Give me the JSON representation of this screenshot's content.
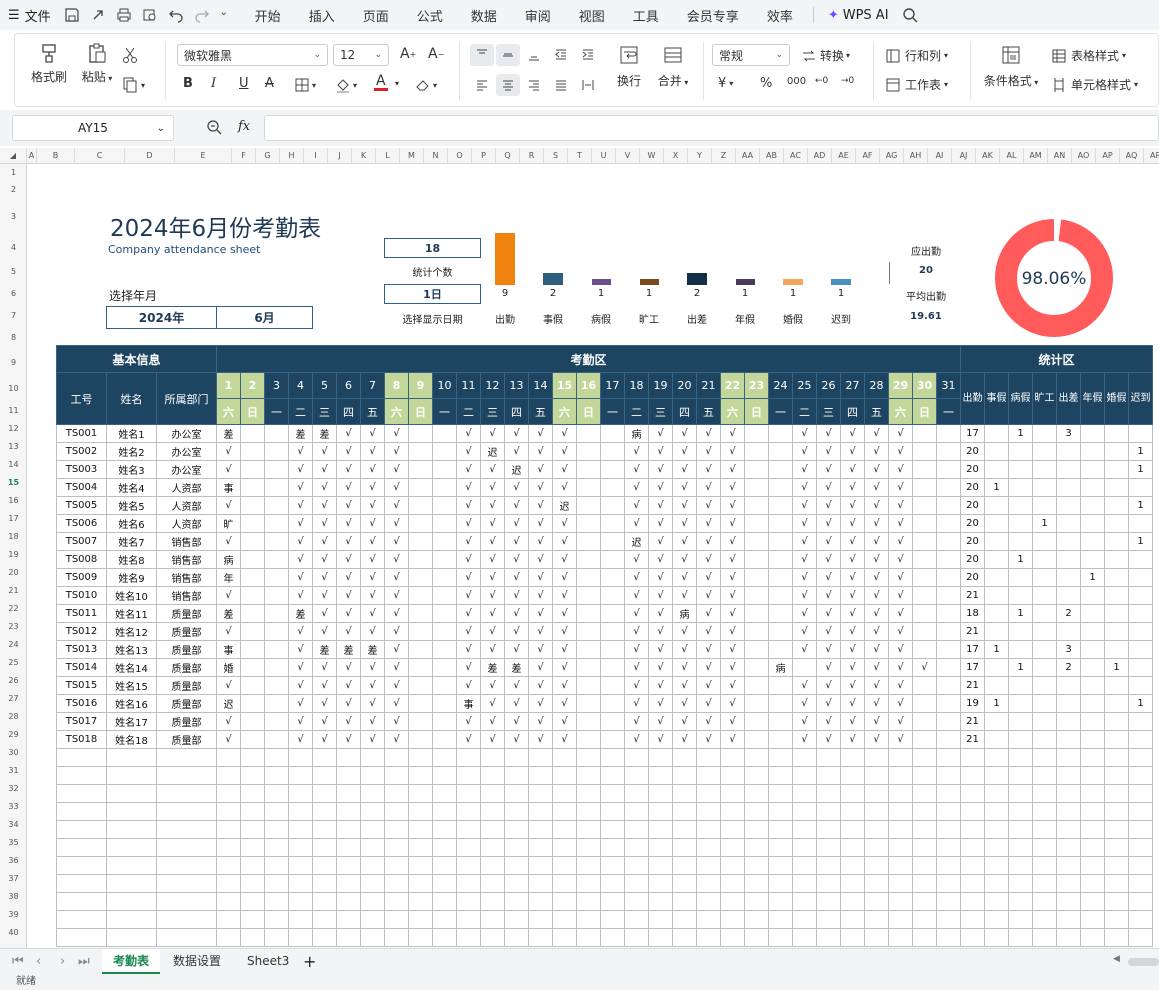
{
  "menubar": {
    "file": "文件",
    "tabs": [
      "开始",
      "插入",
      "页面",
      "公式",
      "数据",
      "审阅",
      "视图",
      "工具",
      "会员专享",
      "效率"
    ],
    "active_tab": "开始",
    "ai": "WPS AI"
  },
  "ribbon": {
    "format_painter": "格式刷",
    "paste": "粘贴",
    "font_name": "微软雅黑",
    "font_size": "12",
    "wrap": "换行",
    "merge": "合并",
    "number_format": "常规",
    "convert": "转换",
    "row_col": "行和列",
    "worksheet": "工作表",
    "cond_format": "条件格式",
    "table_style": "表格样式",
    "cell_style": "单元格样式"
  },
  "formula_bar": {
    "name_box": "AY15",
    "fx": "fx"
  },
  "columns": [
    "A",
    "B",
    "C",
    "D",
    "E",
    "F",
    "G",
    "H",
    "I",
    "J",
    "K",
    "L",
    "M",
    "N",
    "O",
    "P",
    "Q",
    "R",
    "S",
    "T",
    "U",
    "V",
    "W",
    "X",
    "Y",
    "Z",
    "AA",
    "AB",
    "AC",
    "AD",
    "AE",
    "AF",
    "AG",
    "AH",
    "AI",
    "AJ",
    "AK",
    "AL",
    "AM",
    "AN",
    "AO",
    "AP",
    "AQ",
    "AR"
  ],
  "dashboard": {
    "title": "2024年6月份考勤表",
    "subtitle": "Company attendance sheet",
    "select_label": "选择年月",
    "year": "2024年",
    "month": "6月",
    "count_value": "18",
    "count_label": "统计个数",
    "date_value": "1日",
    "date_label": "选择显示日期",
    "expected_label": "应出勤",
    "expected_value": "20",
    "avg_label": "平均出勤",
    "avg_value": "19.61",
    "rate_label": "98.06%",
    "rate_fraction": 0.9806,
    "colors": {
      "ring": "#ff5b5b",
      "ring_gap": "#ffffff",
      "navy": "#1d4562",
      "weekend": "#c4d79b"
    }
  },
  "chart_data": {
    "type": "bar",
    "categories": [
      "出勤",
      "事假",
      "病假",
      "旷工",
      "出差",
      "年假",
      "婚假",
      "迟到"
    ],
    "values": [
      9,
      2,
      1,
      1,
      2,
      1,
      1,
      1
    ],
    "colors": [
      "#f0820f",
      "#2f5d7c",
      "#6b4f8a",
      "#7a4a1e",
      "#132f45",
      "#4a3a5a",
      "#f2a55c",
      "#4a90c0"
    ]
  },
  "table": {
    "sections": {
      "basic": "基本信息",
      "attendance": "考勤区",
      "stats": "统计区"
    },
    "headers": {
      "id": "工号",
      "name": "姓名",
      "dept": "所属部门"
    },
    "days": [
      "1",
      "2",
      "3",
      "4",
      "5",
      "6",
      "7",
      "8",
      "9",
      "10",
      "11",
      "12",
      "13",
      "14",
      "15",
      "16",
      "17",
      "18",
      "19",
      "20",
      "21",
      "22",
      "23",
      "24",
      "25",
      "26",
      "27",
      "28",
      "29",
      "30",
      "31"
    ],
    "weekdays": [
      "六",
      "日",
      "一",
      "二",
      "三",
      "四",
      "五",
      "六",
      "日",
      "一",
      "二",
      "三",
      "四",
      "五",
      "六",
      "日",
      "一",
      "二",
      "三",
      "四",
      "五",
      "六",
      "日",
      "一",
      "二",
      "三",
      "四",
      "五",
      "六",
      "日",
      "一"
    ],
    "weekend_days": [
      1,
      2,
      8,
      9,
      15,
      16,
      22,
      23,
      29,
      30
    ],
    "stat_headers": [
      "出勤",
      "事假",
      "病假",
      "旷工",
      "出差",
      "年假",
      "婚假",
      "迟到"
    ],
    "rows": [
      {
        "id": "TS001",
        "name": "姓名1",
        "dept": "办公室",
        "marks": "差||差差√√√||√√√√√||病√√√√||√√√√√||",
        "stats": [
          "17",
          "",
          "1",
          "",
          "3",
          "",
          "",
          ""
        ]
      },
      {
        "id": "TS002",
        "name": "姓名2",
        "dept": "办公室",
        "marks": "√||√√√√√||√迟√√√||√√√√√||√√√√√||",
        "stats": [
          "20",
          "",
          "",
          "",
          "",
          "",
          "",
          "1"
        ]
      },
      {
        "id": "TS003",
        "name": "姓名3",
        "dept": "办公室",
        "marks": "√||√√√√√||√√迟√√||√√√√√||√√√√√||",
        "stats": [
          "20",
          "",
          "",
          "",
          "",
          "",
          "",
          "1"
        ]
      },
      {
        "id": "TS004",
        "name": "姓名4",
        "dept": "人资部",
        "marks": "事||√√√√√||√√√√√||√√√√√||√√√√√||",
        "stats": [
          "20",
          "1",
          "",
          "",
          "",
          "",
          "",
          ""
        ]
      },
      {
        "id": "TS005",
        "name": "姓名5",
        "dept": "人资部",
        "marks": "√||√√√√√||√√√√迟||√√√√√||√√√√√||",
        "stats": [
          "20",
          "",
          "",
          "",
          "",
          "",
          "",
          "1"
        ]
      },
      {
        "id": "TS006",
        "name": "姓名6",
        "dept": "人资部",
        "marks": "旷||√√√√√||√√√√√||√√√√√||√√√√√||",
        "stats": [
          "20",
          "",
          "",
          "1",
          "",
          "",
          "",
          ""
        ]
      },
      {
        "id": "TS007",
        "name": "姓名7",
        "dept": "销售部",
        "marks": "√||√√√√√||√√√√√||迟√√√√||√√√√√||",
        "stats": [
          "20",
          "",
          "",
          "",
          "",
          "",
          "",
          "1"
        ]
      },
      {
        "id": "TS008",
        "name": "姓名8",
        "dept": "销售部",
        "marks": "病||√√√√√||√√√√√||√√√√√||√√√√√||",
        "stats": [
          "20",
          "",
          "1",
          "",
          "",
          "",
          "",
          ""
        ]
      },
      {
        "id": "TS009",
        "name": "姓名9",
        "dept": "销售部",
        "marks": "年||√√√√√||√√√√√||√√√√√||√√√√√||",
        "stats": [
          "20",
          "",
          "",
          "",
          "",
          "1",
          "",
          ""
        ]
      },
      {
        "id": "TS010",
        "name": "姓名10",
        "dept": "销售部",
        "marks": "√||√√√√√||√√√√√||√√√√√||√√√√√||",
        "stats": [
          "21",
          "",
          "",
          "",
          "",
          "",
          "",
          ""
        ]
      },
      {
        "id": "TS011",
        "name": "姓名11",
        "dept": "质量部",
        "marks": "差||差√√√√||√√√√√||√√病√√||√√√√√||",
        "stats": [
          "18",
          "",
          "1",
          "",
          "2",
          "",
          "",
          ""
        ]
      },
      {
        "id": "TS012",
        "name": "姓名12",
        "dept": "质量部",
        "marks": "√||√√√√√||√√√√√||√√√√√||√√√√√||",
        "stats": [
          "21",
          "",
          "",
          "",
          "",
          "",
          "",
          ""
        ]
      },
      {
        "id": "TS013",
        "name": "姓名13",
        "dept": "质量部",
        "marks": "事||√差差差√||√√√√√||√√√√√||√√√√√||",
        "stats": [
          "17",
          "1",
          "",
          "",
          "3",
          "",
          "",
          ""
        ]
      },
      {
        "id": "TS014",
        "name": "姓名14",
        "dept": "质量部",
        "marks": "婚||√√√√√||√差差√√||√√√√√|病|√√√√√||",
        "stats": [
          "17",
          "",
          "1",
          "",
          "2",
          "",
          "1",
          ""
        ]
      },
      {
        "id": "TS015",
        "name": "姓名15",
        "dept": "质量部",
        "marks": "√||√√√√√||√√√√√||√√√√√||√√√√√||",
        "stats": [
          "21",
          "",
          "",
          "",
          "",
          "",
          "",
          ""
        ]
      },
      {
        "id": "TS016",
        "name": "姓名16",
        "dept": "质量部",
        "marks": "迟||√√√√√||事√√√√||√√√√√||√√√√√||",
        "stats": [
          "19",
          "1",
          "",
          "",
          "",
          "",
          "",
          "1"
        ]
      },
      {
        "id": "TS017",
        "name": "姓名17",
        "dept": "质量部",
        "marks": "√||√√√√√||√√√√√||√√√√√||√√√√√||",
        "stats": [
          "21",
          "",
          "",
          "",
          "",
          "",
          "",
          ""
        ]
      },
      {
        "id": "TS018",
        "name": "姓名18",
        "dept": "质量部",
        "marks": "√||√√√√√||√√√√√||√√√√√||√√√√√||",
        "stats": [
          "21",
          "",
          "",
          "",
          "",
          "",
          "",
          ""
        ]
      }
    ],
    "empty_rows": 11
  },
  "sheet_tabs": [
    "考勤表",
    "数据设置",
    "Sheet3"
  ],
  "active_sheet": "考勤表",
  "status": "就绪"
}
